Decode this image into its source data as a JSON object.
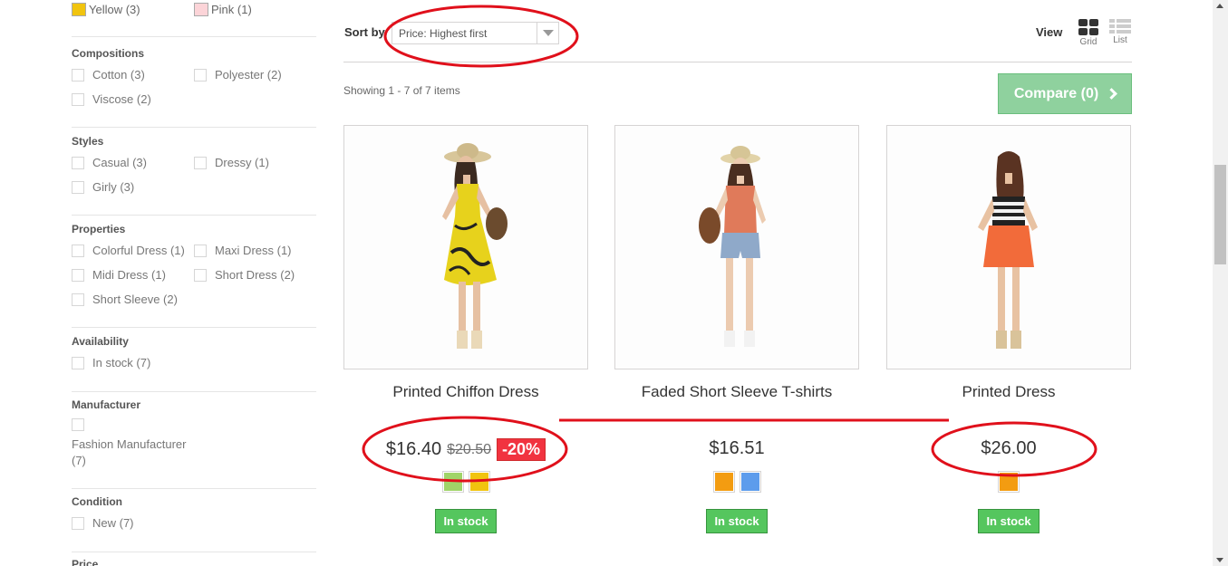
{
  "filters": {
    "colors": [
      {
        "label": "Yellow (3)",
        "color": "#f1c40f"
      },
      {
        "label": "Pink (1)",
        "color": "#fcd4d8"
      }
    ],
    "compositions": {
      "title": "Compositions",
      "options": [
        "Cotton (3)",
        "Polyester (2)",
        "Viscose (2)"
      ]
    },
    "styles": {
      "title": "Styles",
      "options": [
        "Casual (3)",
        "Dressy (1)",
        "Girly (3)"
      ]
    },
    "properties": {
      "title": "Properties",
      "options": [
        "Colorful Dress (1)",
        "Maxi Dress (1)",
        "Midi Dress (1)",
        "Short Dress (2)",
        "Short Sleeve (2)"
      ]
    },
    "availability": {
      "title": "Availability",
      "options": [
        "In stock (7)"
      ]
    },
    "manufacturer": {
      "title": "Manufacturer",
      "options": [
        "Fashion Manufacturer",
        "(7)"
      ]
    },
    "condition": {
      "title": "Condition",
      "options": [
        "New (7)"
      ]
    },
    "price": {
      "title": "Price"
    }
  },
  "toolbar": {
    "sort_label": "Sort by",
    "sort_value": "Price: Highest first",
    "view_label": "View",
    "grid_label": "Grid",
    "list_label": "List",
    "showing": "Showing 1 - 7 of 7 items",
    "compare_label": "Compare (0)"
  },
  "products": [
    {
      "name": "Printed Chiffon Dress",
      "price": "$16.40",
      "old_price": "$20.50",
      "reduction": "-20%",
      "colors": [
        "#a0d468",
        "#f1c40f"
      ],
      "stock": "In stock"
    },
    {
      "name": "Faded Short Sleeve T-shirts",
      "price": "$16.51",
      "colors": [
        "#f39c11",
        "#5d9cec"
      ],
      "stock": "In stock"
    },
    {
      "name": "Printed Dress",
      "price": "$26.00",
      "colors": [
        "#f39c11"
      ],
      "stock": "In stock"
    }
  ],
  "theme": {
    "annotation_red": "#e0101b",
    "stock_green": "#55c65e",
    "compare_green": "#8fd19e"
  }
}
